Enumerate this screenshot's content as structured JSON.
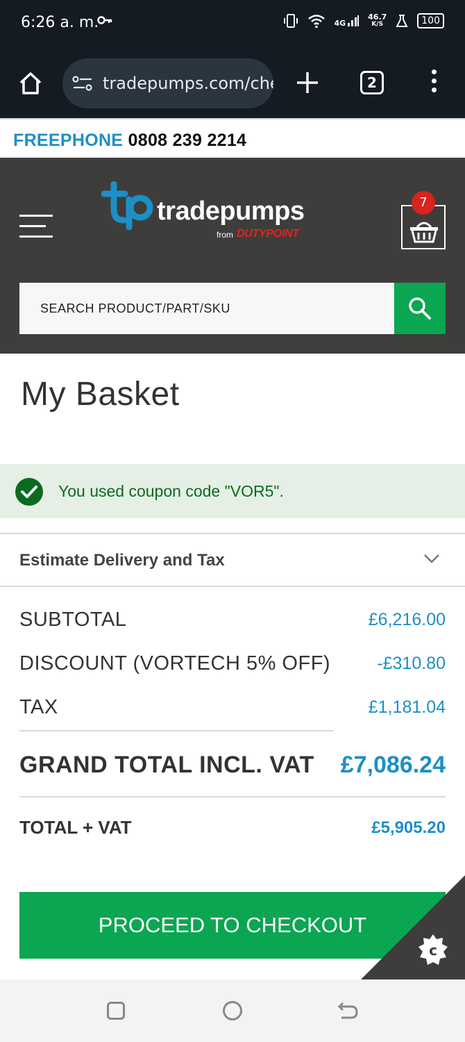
{
  "status_bar": {
    "time": "6:26 a. m.",
    "network": "4G",
    "speed_value": "46.7",
    "speed_unit": "K/S",
    "battery": "100"
  },
  "browser": {
    "url": "tradepumps.com/checkout/cart",
    "tab_count": "2"
  },
  "freephone": {
    "label": "FREEPHONE",
    "number": "0808 239 2214"
  },
  "header": {
    "logo_text": "tradepumps",
    "logo_from": "from",
    "logo_brand": "DUTYPOINT",
    "cart_count": "7",
    "search_placeholder": "SEARCH PRODUCT/PART/SKU"
  },
  "page": {
    "title": "My Basket",
    "coupon_message": "You used coupon code \"VOR5\"."
  },
  "estimate": {
    "label": "Estimate Delivery and Tax"
  },
  "totals": {
    "subtotal_label": "SUBTOTAL",
    "subtotal_value": "£6,216.00",
    "discount_label": "DISCOUNT (VORTECH 5% OFF)",
    "discount_value": "-£310.80",
    "tax_label": "TAX",
    "tax_value": "£1,181.04",
    "grand_label": "GRAND TOTAL INCL. VAT",
    "grand_value": "£7,086.24",
    "vat_label": "TOTAL + VAT",
    "vat_value": "£5,905.20"
  },
  "checkout": {
    "label": "PROCEED TO CHECKOUT"
  },
  "colors": {
    "accent_blue": "#1d8fc7",
    "green": "#0aa651",
    "header_bg": "#3e3d3b",
    "badge_red": "#d8231f"
  },
  "icons": [
    "home-icon",
    "tune-icon",
    "plus-icon",
    "more-vert-icon",
    "hamburger-icon",
    "basket-icon",
    "search-icon",
    "check-circle-icon",
    "chevron-down-icon",
    "cookie-icon"
  ]
}
